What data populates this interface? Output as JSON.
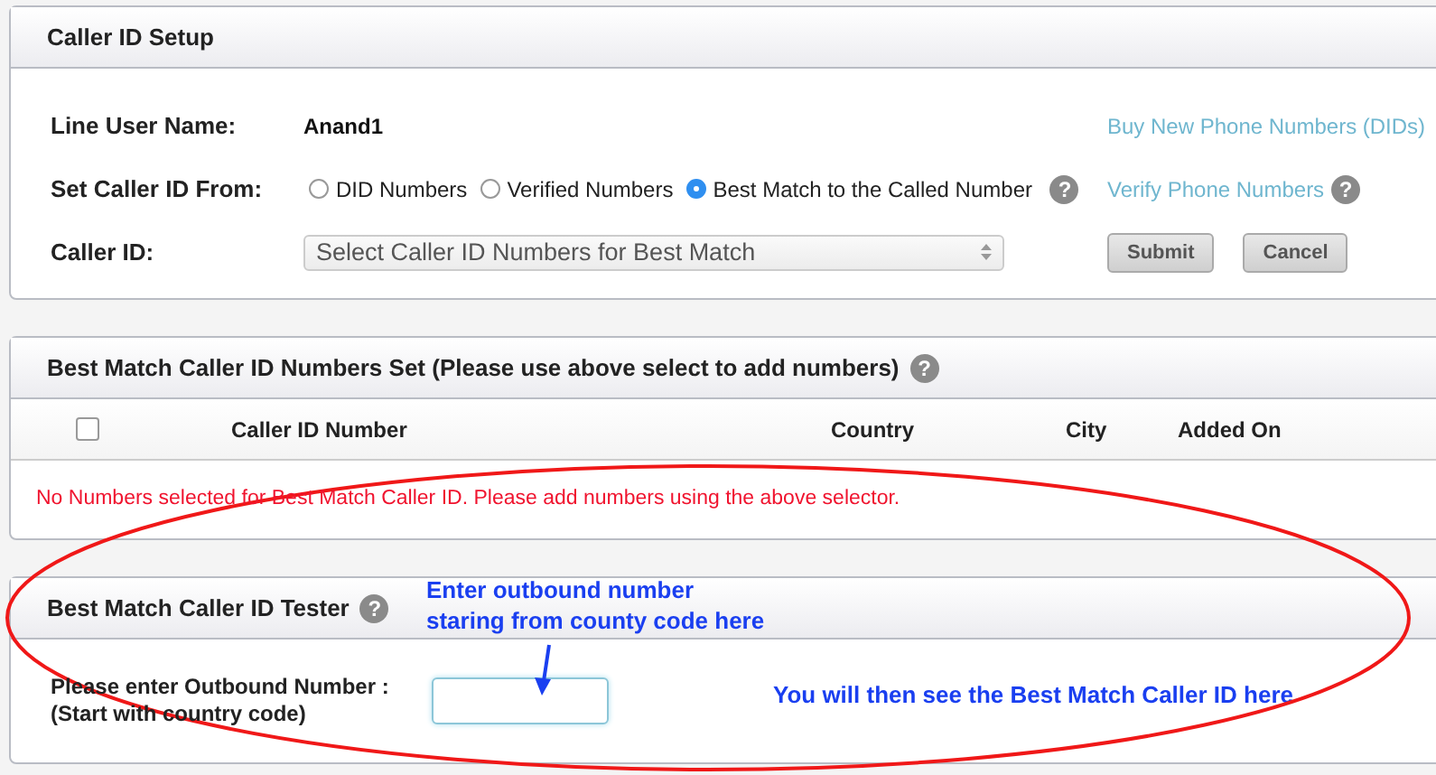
{
  "setup": {
    "title": "Caller ID Setup",
    "line_user_label": "Line User Name:",
    "line_user_value": "Anand1",
    "buy_link": "Buy New Phone Numbers (DIDs)",
    "set_from_label": "Set Caller ID From:",
    "options": [
      {
        "label": "DID Numbers",
        "selected": false
      },
      {
        "label": "Verified Numbers",
        "selected": false
      },
      {
        "label": "Best Match to the Called Number",
        "selected": true
      }
    ],
    "help": "?",
    "verify_link": "Verify Phone Numbers",
    "verify_help": "?",
    "caller_id_label": "Caller ID:",
    "caller_id_select": "Select Caller ID Numbers for Best Match",
    "buttons": [
      "Submit",
      "Cancel"
    ]
  },
  "numbers_set": {
    "title": "Best Match Caller ID Numbers Set (Please use above select to add numbers)",
    "help": "?",
    "select_all_checked": false,
    "columns": [
      "Caller ID Number",
      "Country",
      "City",
      "Added On"
    ],
    "message": "No Numbers selected for Best Match Caller ID. Please add numbers using the above selector."
  },
  "tester": {
    "title": "Best Match Caller ID Tester",
    "help": "?",
    "label_lines": [
      "Please enter Outbound Number :",
      "(Start with country code)"
    ]
  },
  "annotations": {
    "hint_lines": [
      "Enter outbound number",
      "staring from county code here"
    ],
    "result_note": "You will then see the Best Match Caller ID here"
  }
}
